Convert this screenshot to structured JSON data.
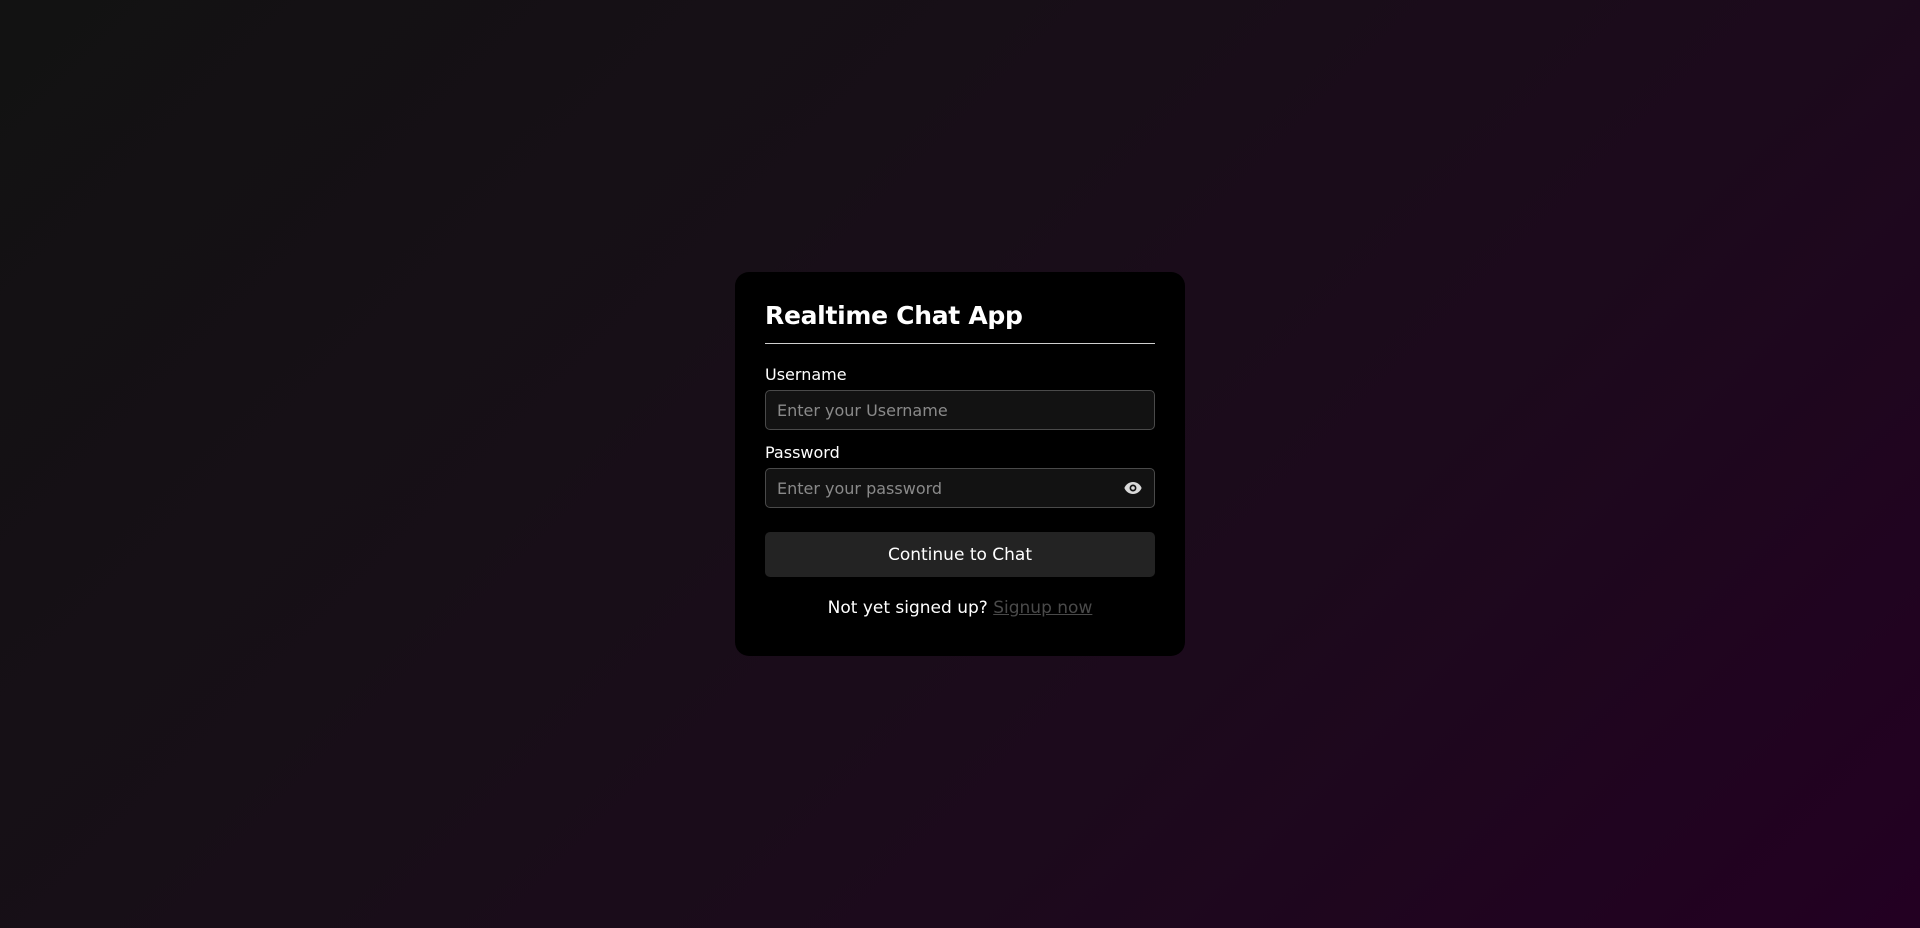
{
  "app": {
    "title": "Realtime Chat App"
  },
  "form": {
    "username_label": "Username",
    "username_placeholder": "Enter your Username",
    "username_value": "",
    "password_label": "Password",
    "password_placeholder": "Enter your password",
    "password_value": "",
    "password_toggle_icon": "eye-icon",
    "submit_label": "Continue to Chat"
  },
  "signup": {
    "prompt": "Not yet signed up?",
    "link_label": "Signup now"
  },
  "colors": {
    "card_background": "#000000",
    "input_background": "#121212",
    "button_background": "#232323",
    "link_color": "#4a4a4a",
    "background_gradient_end": "#230022"
  }
}
